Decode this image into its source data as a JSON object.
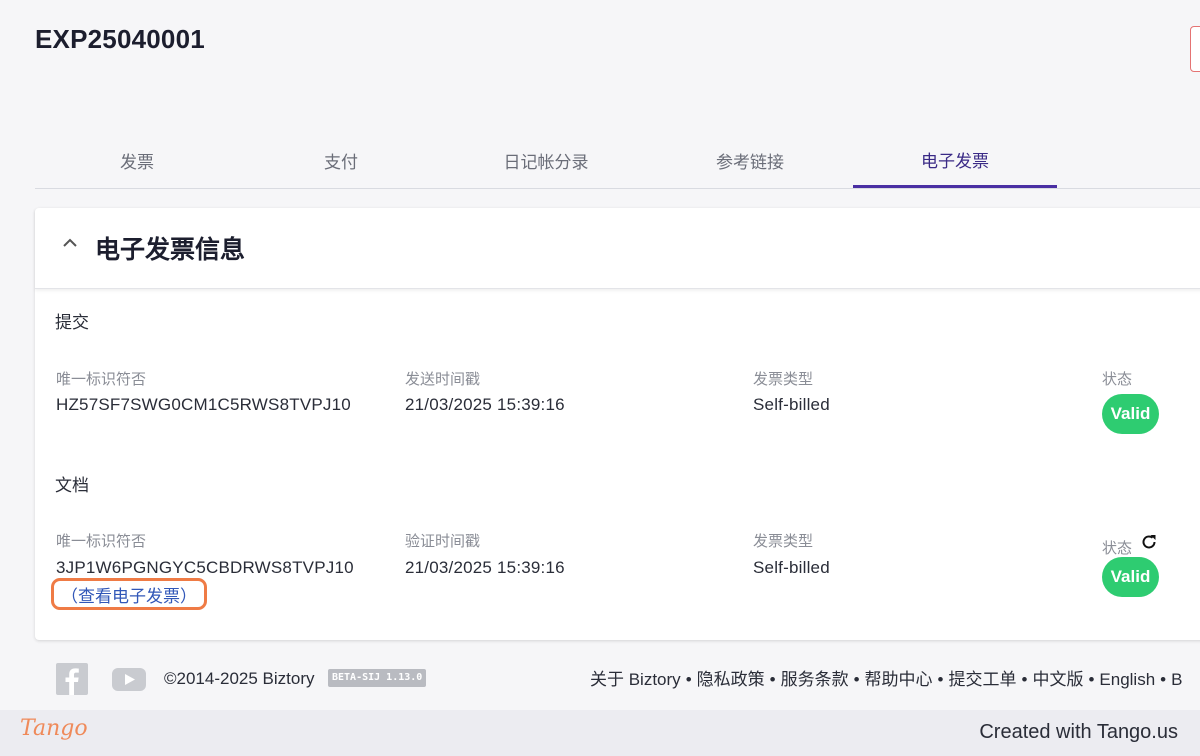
{
  "header": {
    "doc_id": "EXP25040001"
  },
  "tabs": [
    {
      "label": "发票"
    },
    {
      "label": "支付"
    },
    {
      "label": "日记帐分录"
    },
    {
      "label": "参考链接"
    },
    {
      "label": "电子发票",
      "active": true
    }
  ],
  "einvoice": {
    "title": "电子发票信息",
    "submission": {
      "section_title": "提交",
      "uid_label": "唯一标识符否",
      "uid_value": "HZ57SF7SWG0CM1C5RWS8TVPJ10",
      "time_label": "发送时间戳",
      "time_value": "21/03/2025 15:39:16",
      "type_label": "发票类型",
      "type_value": "Self-billed",
      "status_label": "状态",
      "status_value": "Valid"
    },
    "document": {
      "section_title": "文档",
      "uid_label": "唯一标识符否",
      "uid_value": "3JP1W6PGNGYC5CBDRWS8TVPJ10",
      "view_link": "（查看电子发票）",
      "time_label": "验证时间戳",
      "time_value": "21/03/2025 15:39:16",
      "type_label": "发票类型",
      "type_value": "Self-billed",
      "status_label": "状态",
      "status_value": "Valid"
    }
  },
  "footer": {
    "copyright": "©2014-2025 Biztory",
    "version": "BETA-SIJ 1.13.0",
    "links": [
      "关于 Biztory",
      "隐私政策",
      "服务条款",
      "帮助中心",
      "提交工单",
      "中文版",
      "English",
      "B"
    ]
  },
  "tango": {
    "logo": "Tango",
    "credit": "Created with Tango.us"
  },
  "colors": {
    "accent": "#4a2fa3",
    "valid": "#2ecc71",
    "highlight": "#ef7b45",
    "link": "#3157b8"
  },
  "icons": [
    "chevron-up-icon",
    "refresh-icon",
    "facebook-icon",
    "youtube-icon"
  ]
}
